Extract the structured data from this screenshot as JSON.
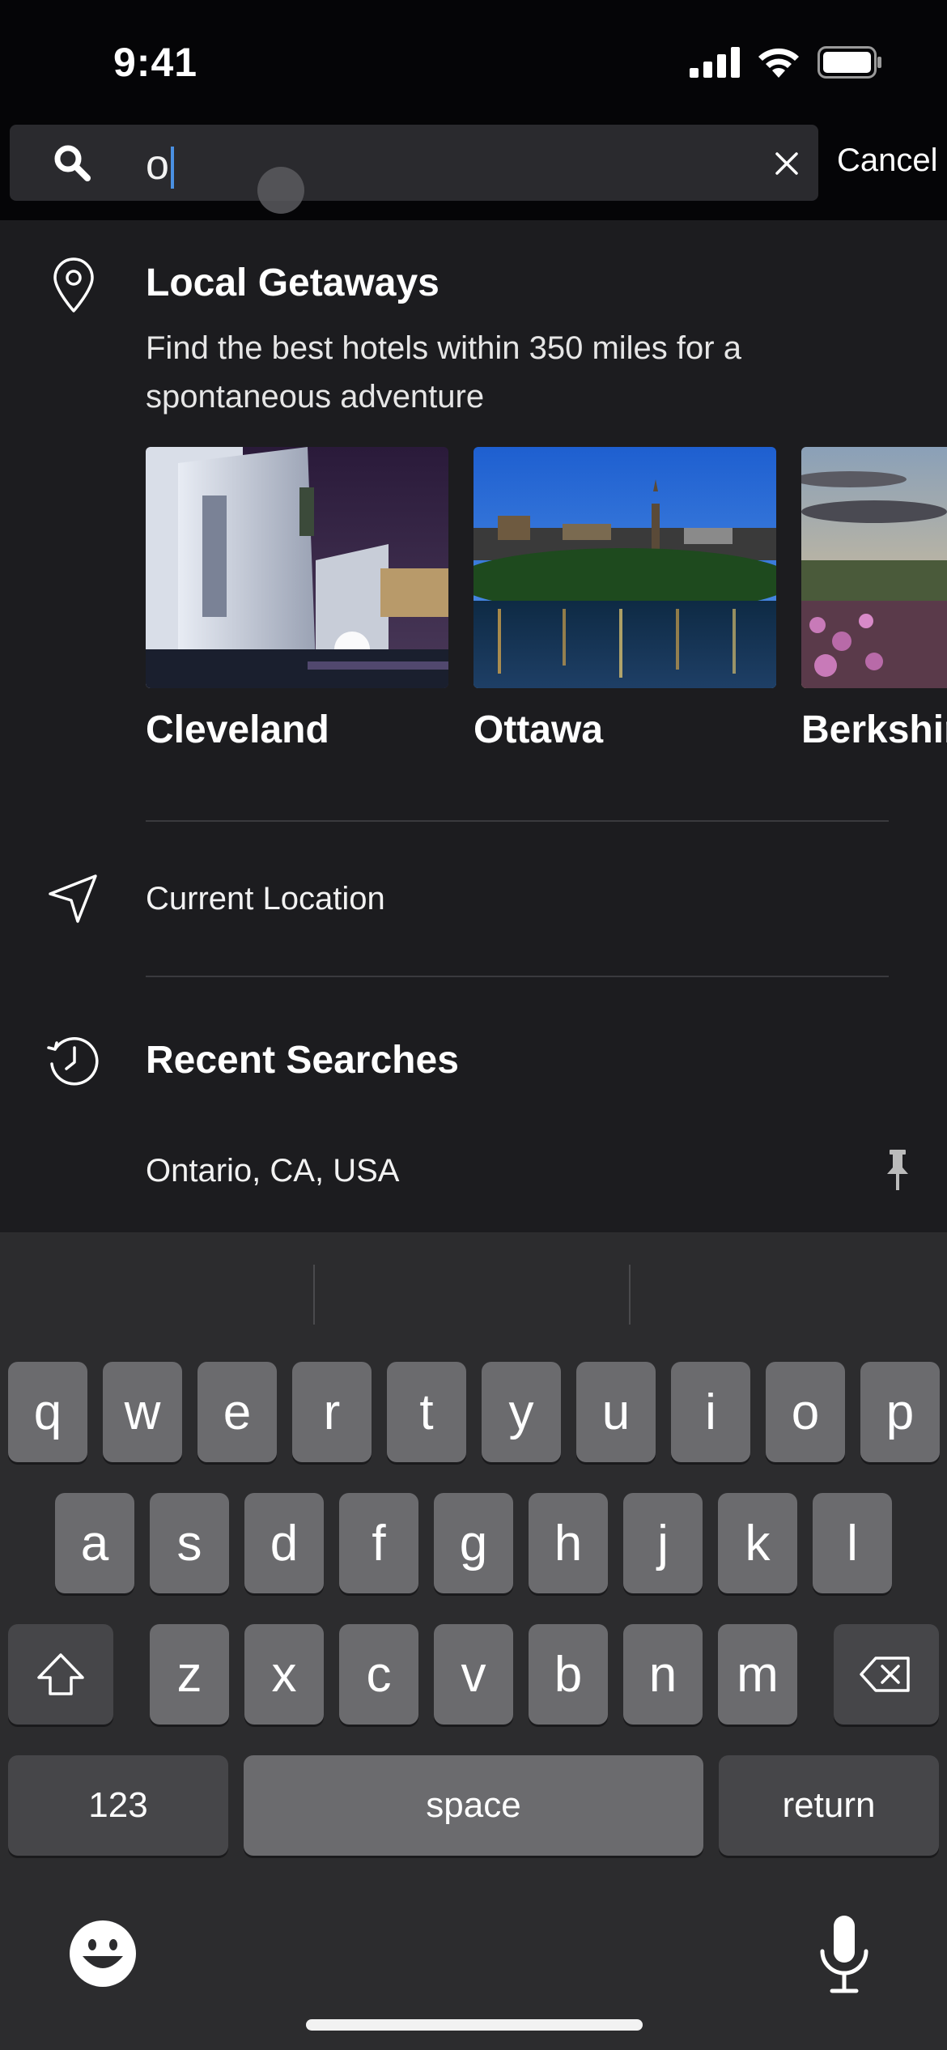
{
  "status": {
    "time": "9:41"
  },
  "search": {
    "value": "o",
    "cancel_label": "Cancel"
  },
  "local_getaways": {
    "title": "Local Getaways",
    "subtitle": "Find the best hotels within 350 miles for a spontaneous adventure",
    "destinations": [
      {
        "label": "Cleveland"
      },
      {
        "label": "Ottawa"
      },
      {
        "label": "Berkshir"
      }
    ]
  },
  "current_location": {
    "label": "Current Location"
  },
  "recent_searches": {
    "title": "Recent Searches",
    "items": [
      {
        "label": "Ontario, CA, USA"
      }
    ]
  },
  "keyboard": {
    "row1": [
      "q",
      "w",
      "e",
      "r",
      "t",
      "y",
      "u",
      "i",
      "o",
      "p"
    ],
    "row2": [
      "a",
      "s",
      "d",
      "f",
      "g",
      "h",
      "j",
      "k",
      "l"
    ],
    "row3": [
      "z",
      "x",
      "c",
      "v",
      "b",
      "n",
      "m"
    ],
    "numbers_label": "123",
    "space_label": "space",
    "return_label": "return"
  },
  "colors": {
    "background": "#1c1c1f",
    "keyboard": "#2c2c2e",
    "key": "#6b6b6e",
    "cursor": "#4a90e2"
  }
}
